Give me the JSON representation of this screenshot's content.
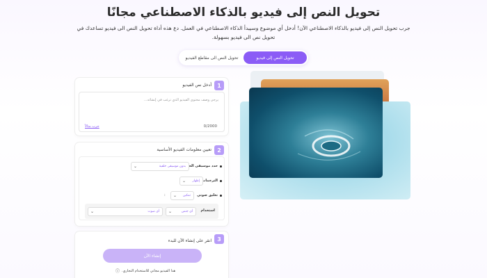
{
  "hero": {
    "title": "تحويل النص إلى فيديو بالذكاء الاصطناعي مجانًا",
    "subtitle": "جرب تحويل النص إلى فيديو بالذكاء الاصطناعي الآن! أدخل أي موضوع وسيبدأ الذكاء الاصطناعي في العمل. دع هذه أداة تحويل النص الى فيديو تساعدك في تحويل نص الى فيديو بسهولة."
  },
  "tabs": [
    {
      "label": "تحويل النص إلى فيديو",
      "active": true
    },
    {
      "label": "تحويل النص الى مقاطع الفيديو",
      "active": false
    }
  ],
  "step1": {
    "number": "1",
    "label": "أدخل نص الفيديو",
    "placeholder": "يرجى وصف محتوى الفيديو الذي ترغب في إنشائه...",
    "counter": "0/2000",
    "example_link": "جرب مثالاً"
  },
  "step2": {
    "number": "2",
    "label": "تعيين معلومات الفيديو الأساسية",
    "music_label": "حدد موسيقى الخلفية",
    "music_value": "بدون موسيقى خلفية",
    "subtitles_label": "الترجمات",
    "subtitles_value": "إظهار",
    "voice_label": "تعليق صوتي",
    "voice_value": "تمكين",
    "colon": ":",
    "use_label": "استخدام",
    "gender_value": "أي جنس",
    "voice_select_value": "أي صوت"
  },
  "step3": {
    "number": "3",
    "label": "انقر على إنشاء الآن للبدء",
    "button": "إنشاء الآن",
    "free_note": "هذا الفيديو مجاني للاستخدام التجاري."
  },
  "icons": {
    "info": "info-icon",
    "chevron": "chevron-down-icon"
  },
  "colors": {
    "accent": "#8b5cf6",
    "accent_light": "#b79cf8",
    "button_disabled": "#c9b3f8"
  }
}
